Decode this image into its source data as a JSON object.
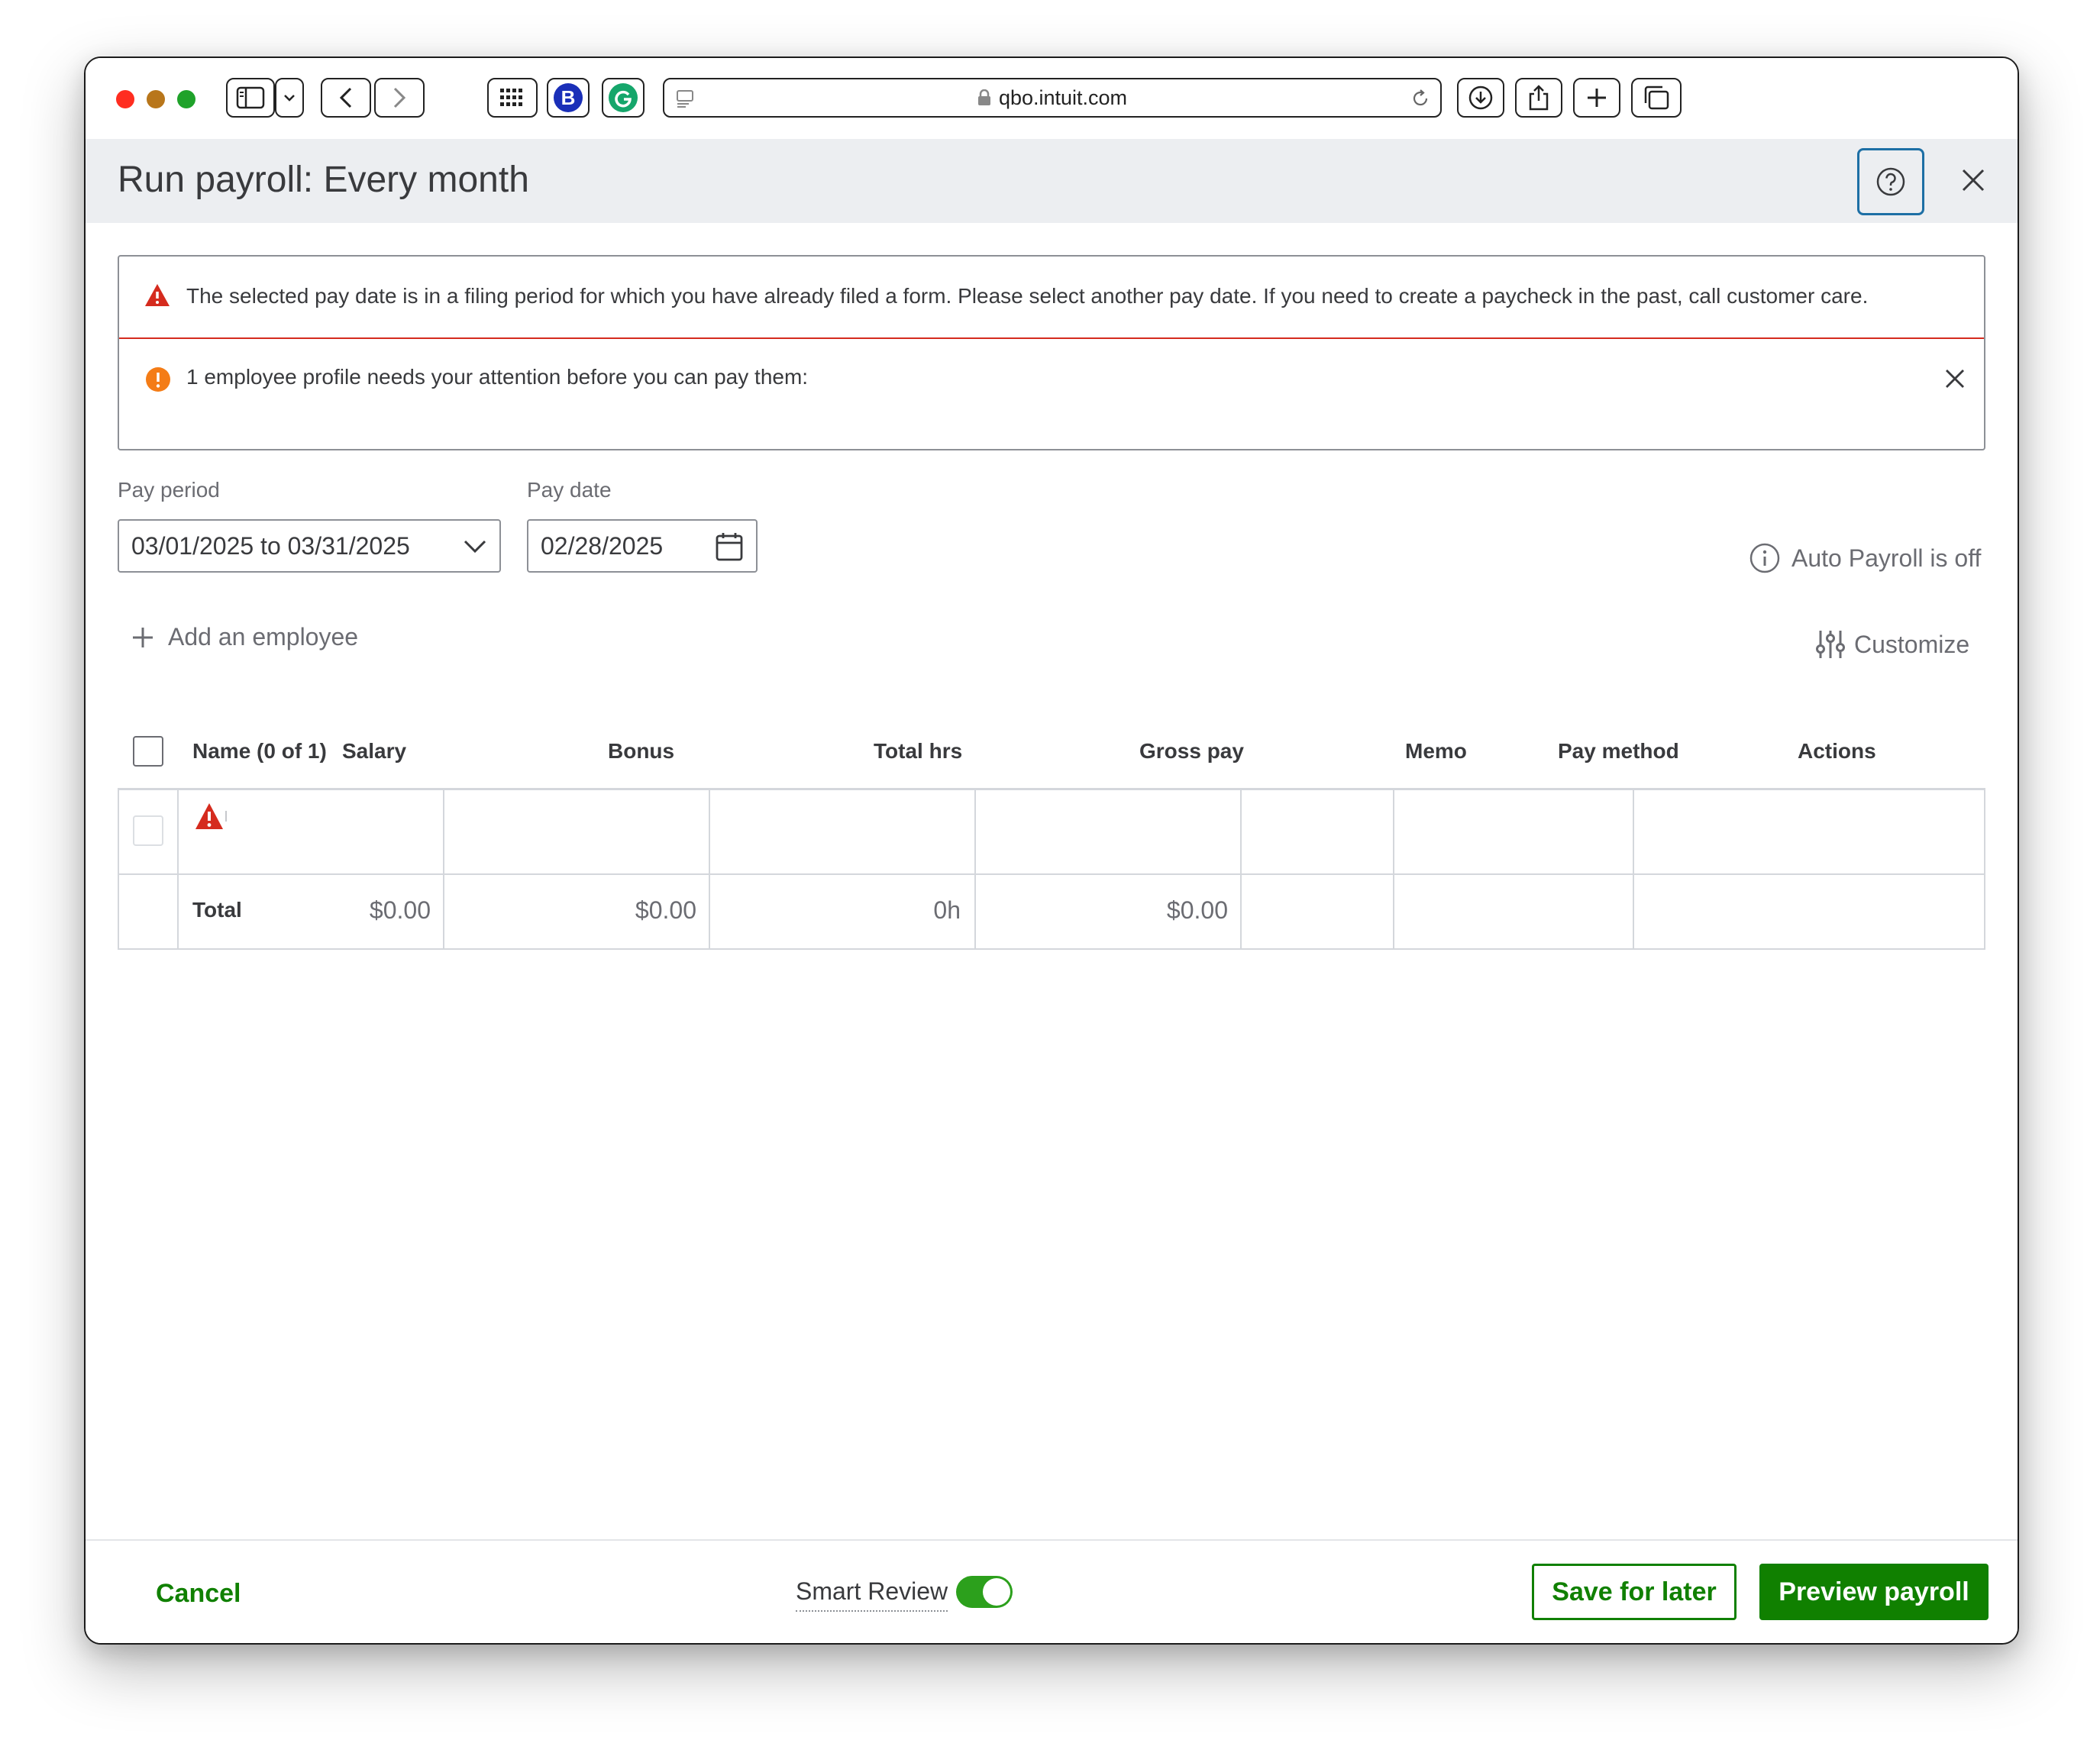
{
  "browser": {
    "url": "qbo.intuit.com",
    "extension_b_label": "B"
  },
  "modal": {
    "title": "Run payroll: Every month"
  },
  "alerts": {
    "error_message": "The selected pay date is in a filing period for which you have already filed a form. Please select another pay date. If you need to create a paycheck in the past, call customer care.",
    "warning_message": "1 employee profile needs your attention before you can pay them:"
  },
  "form": {
    "pay_period_label": "Pay period",
    "pay_period_value": "03/01/2025 to 03/31/2025",
    "pay_date_label": "Pay date",
    "pay_date_value": "02/28/2025",
    "auto_payroll_status": "Auto Payroll is off",
    "add_employee_label": "Add an employee",
    "customize_label": "Customize"
  },
  "table": {
    "headers": [
      "Name (0 of 1)",
      "Salary",
      "Bonus",
      "Total hrs",
      "Gross pay",
      "Memo",
      "Pay method",
      "Actions"
    ],
    "totals": {
      "label": "Total",
      "salary": "$0.00",
      "bonus": "$0.00",
      "total_hrs": "0h",
      "gross_pay": "$0.00"
    }
  },
  "footer": {
    "cancel_label": "Cancel",
    "smart_review_label": "Smart Review",
    "smart_review_on": true,
    "save_later_label": "Save for later",
    "preview_label": "Preview payroll"
  },
  "colors": {
    "brand_green": "#108000",
    "toggle_green": "#2ca01c",
    "error_red": "#d52b1e",
    "warning_orange": "#f47c16",
    "help_blue": "#1d6fa5"
  }
}
